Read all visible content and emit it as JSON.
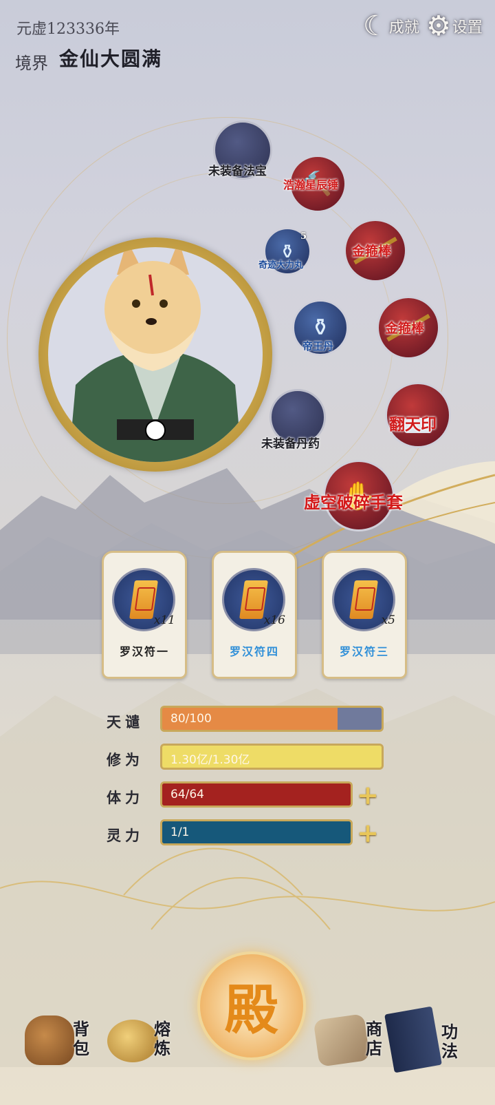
{
  "header": {
    "year": "元虚123336年",
    "realm_label": "境界",
    "realm_value": "金仙大圆满"
  },
  "top_buttons": {
    "achievements": "成就",
    "settings": "设置"
  },
  "equipment": {
    "treasure_slot": "未装备法宝",
    "hammer": "浩瀚星辰锤",
    "pill_small": "奇迹大力丸",
    "pill_small_count": "5",
    "staff_1": "金箍棒",
    "pill_emperor": "帝王丹",
    "staff_2": "金箍棒",
    "seal": "翻天印",
    "pill_slot": "未装备丹药",
    "gloves": "虚空破碎手套"
  },
  "talismans": [
    {
      "name": "罗汉符一",
      "count": "x11",
      "color": "#1f1f1f"
    },
    {
      "name": "罗汉符四",
      "count": "x16",
      "color": "#2f8fd8"
    },
    {
      "name": "罗汉符三",
      "count": "x5",
      "color": "#2f8fd8"
    }
  ],
  "stats": {
    "talent_label": "天谴",
    "talent_value": "80/100",
    "talent_fraction": 0.8,
    "power_label": "修为",
    "power_value": "1.30亿/1.30亿",
    "power_fraction": 1.0,
    "stamina_label": "体力",
    "stamina_value": "64/64",
    "stamina_fraction": 1.0,
    "spirit_label": "灵力",
    "spirit_value": "1/1",
    "spirit_fraction": 1.0
  },
  "nav": {
    "bag": "背包",
    "smelt": "熔炼",
    "center": "殿",
    "shop": "商店",
    "skill": "功法"
  },
  "colors": {
    "talent": "#e58a45",
    "power": "#eedc66",
    "stamina": "#a4221f",
    "spirit": "#16587a",
    "gold": "#c8a85a"
  }
}
